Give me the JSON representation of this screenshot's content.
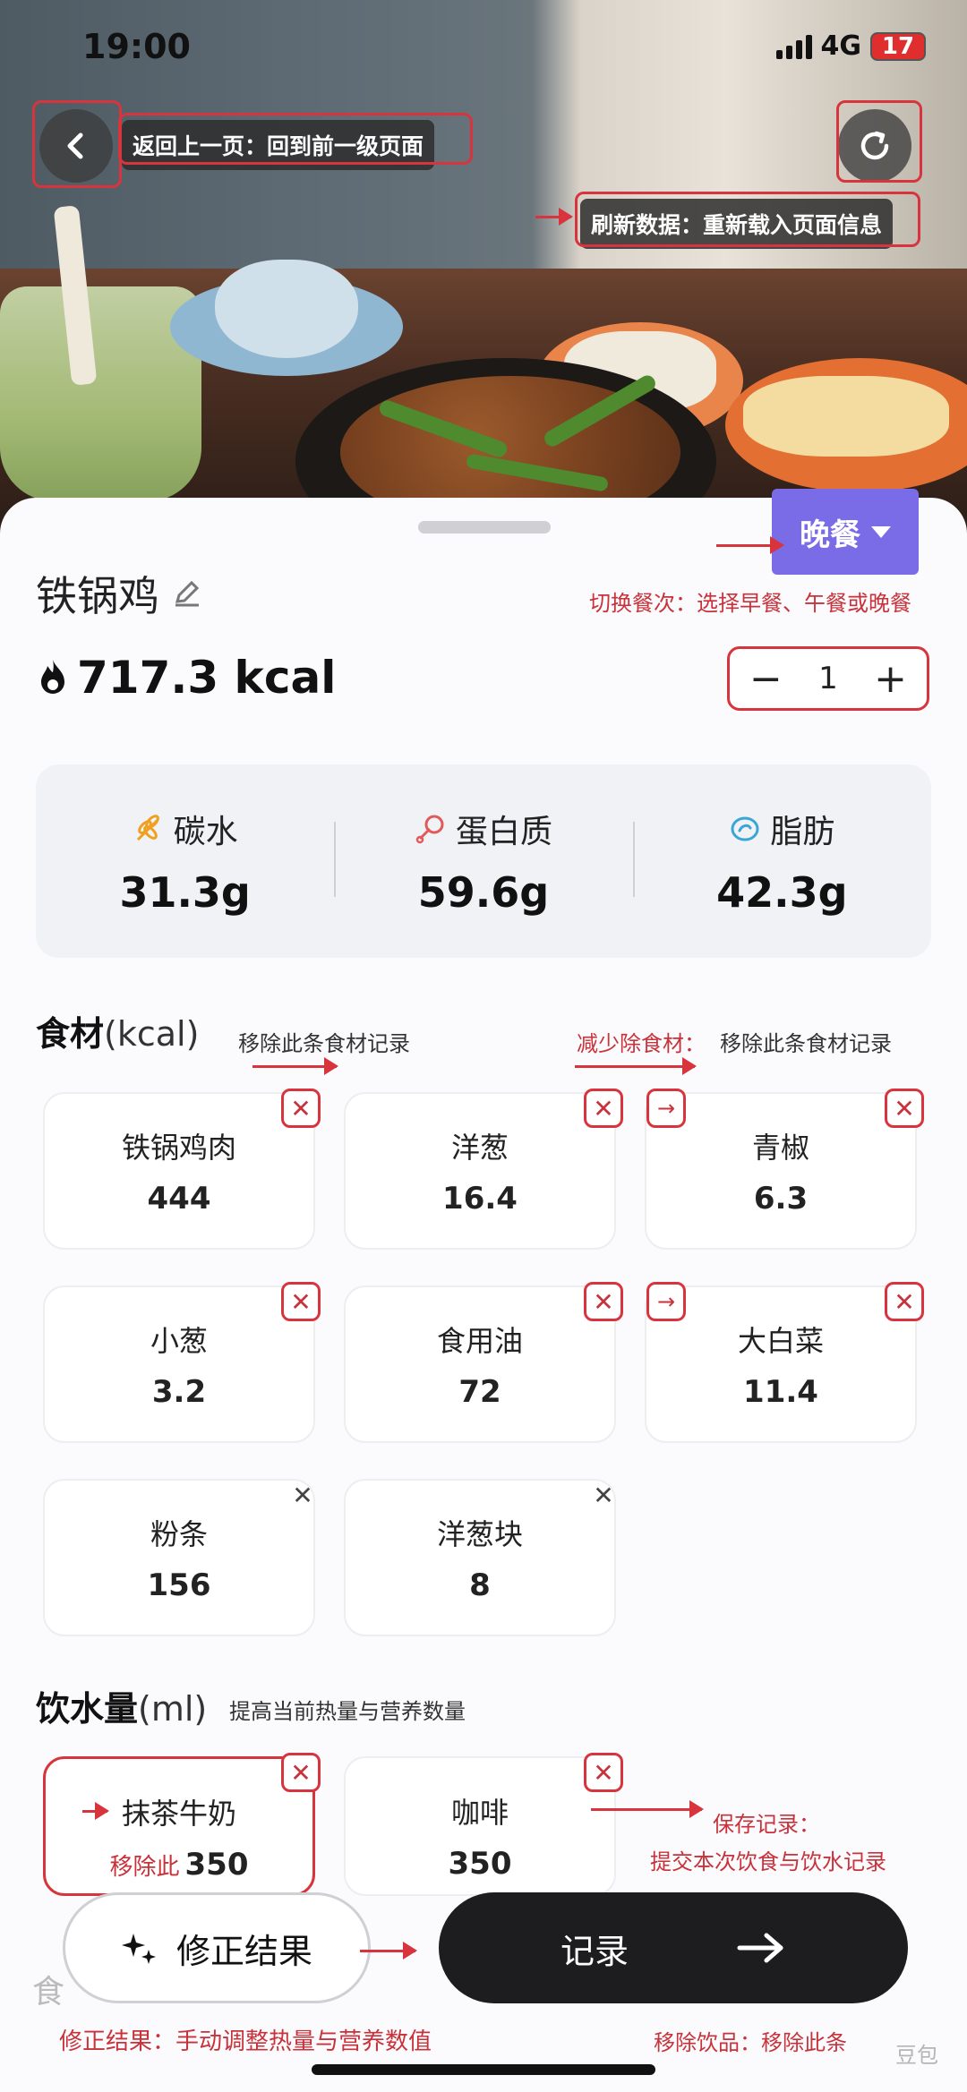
{
  "status_bar": {
    "time": "19:00",
    "network": "4G",
    "battery": "17"
  },
  "header": {
    "back_tip": "返回上一页：回到前一级页面",
    "refresh_tip": "刷新数据：重新载入页面信息"
  },
  "meal": {
    "label": "晚餐",
    "annotation": "切换餐次：选择早餐、午餐或晚餐"
  },
  "food": {
    "name": "铁锅鸡",
    "kcal": "717.3 kcal",
    "quantity": "1"
  },
  "macros": [
    {
      "label": "碳水",
      "value": "31.3g",
      "color": "#f0a020"
    },
    {
      "label": "蛋白质",
      "value": "59.6g",
      "color": "#e05a5a"
    },
    {
      "label": "脂肪",
      "value": "42.3g",
      "color": "#3aa6d8"
    }
  ],
  "ingredients_section": {
    "title": "食材",
    "unit": "(kcal)",
    "annotation_left": "移除此条食材记录",
    "annotation_right_red": "减少除食材：",
    "annotation_right_dark": "移除此条食材记录",
    "items": [
      {
        "name": "铁锅鸡肉",
        "value": "444",
        "btn": "✕"
      },
      {
        "name": "洋葱",
        "value": "16.4",
        "btn": "✕"
      },
      {
        "name": "青椒",
        "value": "6.3",
        "btn": "✕"
      },
      {
        "name": "小葱",
        "value": "3.2",
        "btn": "✕"
      },
      {
        "name": "食用油",
        "value": "72",
        "btn": "✕"
      },
      {
        "name": "大白菜",
        "value": "11.4",
        "btn": "✕"
      },
      {
        "name": "粉条",
        "value": "156",
        "btn": "✕"
      },
      {
        "name": "洋葱块",
        "value": "8",
        "btn": "✕"
      }
    ]
  },
  "drinks_section": {
    "title": "饮水量",
    "unit": "(ml)",
    "annotation": "提高当前热量与营养数量",
    "items": [
      {
        "name": "抹茶牛奶",
        "value": "350",
        "prefix": "移除此"
      },
      {
        "name": "咖啡",
        "value": "350"
      }
    ],
    "save_annotation_1": "保存记录：",
    "save_annotation_2": "提交本次饮食与饮水记录"
  },
  "bottom": {
    "fix_label": "修正结果",
    "record_label": "记录",
    "fix_annotation": "修正结果：手动调整热量与营养数值",
    "remove_drink_annotation": "移除饮品：移除此条",
    "hidden_section_letter": "食",
    "watermark": "豆包"
  }
}
